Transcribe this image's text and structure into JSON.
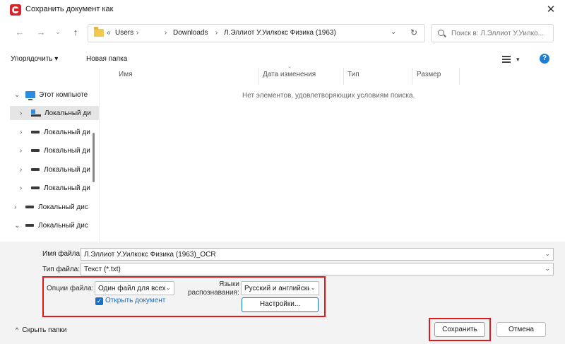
{
  "window": {
    "title": "Сохранить документ как",
    "close_glyph": "✕"
  },
  "nav": {
    "back_glyph": "←",
    "forward_glyph": "→",
    "history_glyph": "⌄",
    "up_glyph": "↑"
  },
  "address": {
    "crumb_prefix": "«",
    "crumbs": [
      "Users",
      "Downloads",
      "Л.Эллиот У.Уилкокс Физика (1963)"
    ],
    "sep": "›",
    "dropdown_glyph": "⌄",
    "refresh_glyph": "↻"
  },
  "search": {
    "placeholder": "Поиск в: Л.Эллиот У.Уилко..."
  },
  "toolbar": {
    "organize_label": "Упорядочить ▾",
    "new_folder_label": "Новая папка",
    "help_glyph": "?"
  },
  "sidebar": {
    "items": [
      {
        "label": "Этот компьюте",
        "chevron": "⌄"
      },
      {
        "label": "Локальный ди",
        "chevron": "›"
      },
      {
        "label": "Локальный ди",
        "chevron": "›"
      },
      {
        "label": "Локальный ди",
        "chevron": "›"
      },
      {
        "label": "Локальный ди",
        "chevron": "›"
      },
      {
        "label": "Локальный ди",
        "chevron": "›"
      },
      {
        "label": "Локальный дис",
        "chevron": "›"
      },
      {
        "label": "Локальный дис",
        "chevron": "⌄"
      }
    ]
  },
  "filelist": {
    "columns": [
      "Имя",
      "Дата изменения",
      "Тип",
      "Размер"
    ],
    "empty_message": "Нет элементов, удовлетворяющих условиям поиска."
  },
  "form": {
    "filename_label": "Имя файла:",
    "filename_value": "Л.Эллиот У.Уилкокс Физика (1963)_OCR",
    "filetype_label": "Тип файла:",
    "filetype_value": "Текст (*.txt)",
    "dropdown_glyph": "⌄"
  },
  "options": {
    "file_options_label": "Опции файла:",
    "file_options_value": "Один файл для всех",
    "open_document_label": "Открыть документ",
    "open_document_checked": true,
    "check_glyph": "✓",
    "languages_label_line1": "Языки",
    "languages_label_line2": "распознавания:",
    "languages_value": "Русский и английски",
    "settings_label": "Настройки..."
  },
  "footer": {
    "hide_folders_label": "Скрыть папки",
    "hide_folders_chevron": "^",
    "save_label": "Сохранить",
    "cancel_label": "Отмена"
  },
  "colors": {
    "highlight_red": "#e0191e",
    "accent_blue": "#1a6fc9",
    "app_red": "#d6262b"
  }
}
